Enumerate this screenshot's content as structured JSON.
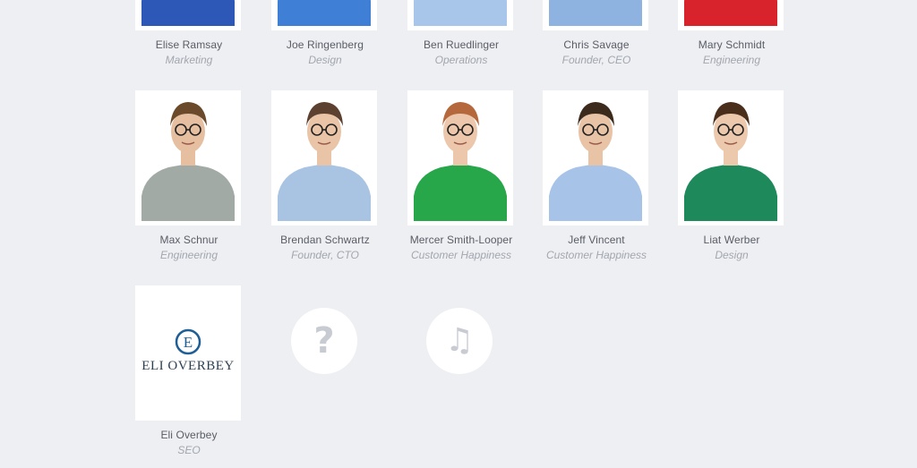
{
  "team": [
    {
      "name": "Elise Ramsay",
      "role": "Marketing",
      "shirt": "#2e58b8",
      "skin": "#e9c3a8",
      "hair": "#5b3b22",
      "photo_icon": "person-photo"
    },
    {
      "name": "Joe Ringenberg",
      "role": "Design",
      "shirt": "#3f7fd6",
      "skin": "#e8c0a2",
      "hair": "#4a3322",
      "photo_icon": "person-photo"
    },
    {
      "name": "Ben Ruedlinger",
      "role": "Operations",
      "shirt": "#a7c6ea",
      "skin": "#e8c3a6",
      "hair": "#5a4030",
      "photo_icon": "person-photo"
    },
    {
      "name": "Chris Savage",
      "role": "Founder, CEO",
      "shirt": "#8fb3e0",
      "skin": "#e8c3a6",
      "hair": "#4a3322",
      "photo_icon": "person-photo"
    },
    {
      "name": "Mary Schmidt",
      "role": "Engineering",
      "shirt": "#d8232d",
      "skin": "#ebc7ab",
      "hair": "#3b2417",
      "photo_icon": "person-photo"
    },
    {
      "name": "Max Schnur",
      "role": "Engineering",
      "shirt": "#a2aaa6",
      "skin": "#e6bea0",
      "hair": "#6a4a2b",
      "photo_icon": "person-photo"
    },
    {
      "name": "Brendan Schwartz",
      "role": "Founder, CTO",
      "shirt": "#a9c3e3",
      "skin": "#e9c4a6",
      "hair": "#5c4030",
      "photo_icon": "person-photo"
    },
    {
      "name": "Mercer Smith-Looper",
      "role": "Customer Happiness",
      "shirt": "#27a64a",
      "skin": "#ecc7ab",
      "hair": "#b5683b",
      "photo_icon": "person-photo"
    },
    {
      "name": "Jeff Vincent",
      "role": "Customer Happiness",
      "shirt": "#a7c4e8",
      "skin": "#e8c3a6",
      "hair": "#3c2a1d",
      "photo_icon": "person-photo"
    },
    {
      "name": "Liat Werber",
      "role": "Design",
      "shirt": "#1e8a5c",
      "skin": "#ecc8ad",
      "hair": "#4a2e1c",
      "photo_icon": "person-photo"
    },
    {
      "name": "Eli Overbey",
      "role": "SEO",
      "logo_text": "Eli Overbey",
      "logo_letter": "E",
      "logo_color": "#1f5f96"
    }
  ],
  "placeholders": [
    {
      "icon": "question-mark-icon",
      "glyph": "?"
    },
    {
      "icon": "music-note-icon",
      "glyph": "♫"
    }
  ],
  "colors": {
    "background": "#eeeff3",
    "icon_gray": "#c8cbd2",
    "name_text": "#5a5d66",
    "role_text": "#a2a6ae"
  }
}
